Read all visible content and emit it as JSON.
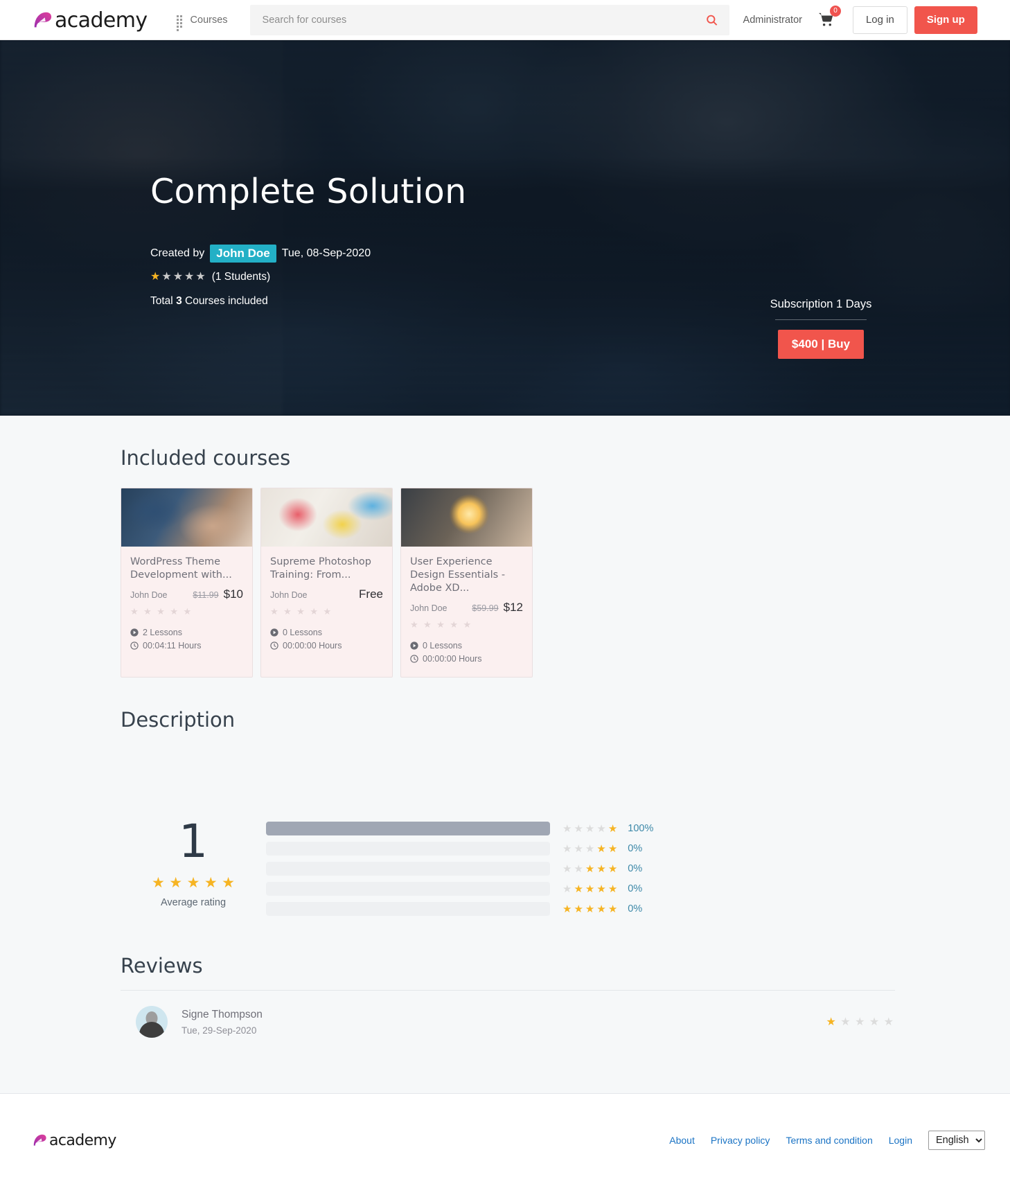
{
  "navbar": {
    "brand": "academy",
    "courses_label": "Courses",
    "search_placeholder": "Search for courses",
    "search_value": "",
    "search_icon": "search-icon",
    "grid_icon": "grid-icon",
    "admin_label": "Administrator",
    "cart_icon": "cart-icon",
    "cart_count": "0",
    "login_label": "Log in",
    "signup_label": "Sign up",
    "accent_red": "#f1554c"
  },
  "hero": {
    "title": "Complete Solution",
    "created_by_label": "Created by",
    "author": "John Doe",
    "created_date": "Tue, 08-Sep-2020",
    "rating_value": 1,
    "rating_max": 5,
    "students_text": "(1 Students)",
    "total_prefix": "Total",
    "total_count": "3",
    "total_suffix": "Courses included",
    "subscription_text": "Subscription 1 Days",
    "buy_label": "$400 | Buy",
    "author_chip_color": "#23b0c6"
  },
  "sections": {
    "included_courses": "Included courses",
    "description": "Description",
    "reviews": "Reviews"
  },
  "courses": [
    {
      "title": "WordPress Theme Development with...",
      "author": "John Doe",
      "price_old": "$11.99",
      "price_new": "$10",
      "stars": 0,
      "lessons": "2 Lessons",
      "hours": "00:04:11 Hours",
      "thumb": "thumb-a"
    },
    {
      "title": "Supreme Photoshop Training: From...",
      "author": "John Doe",
      "price_old": "",
      "price_new": "Free",
      "stars": 0,
      "lessons": "0 Lessons",
      "hours": "00:00:00 Hours",
      "thumb": "thumb-b"
    },
    {
      "title": "User Experience Design Essentials - Adobe XD...",
      "author": "John Doe",
      "price_old": "$59.99",
      "price_new": "$12",
      "stars": 0,
      "lessons": "0 Lessons",
      "hours": "00:00:00 Hours",
      "thumb": "thumb-c"
    }
  ],
  "rating_summary": {
    "average": "1",
    "average_stars": 5,
    "average_label": "Average rating",
    "rows": [
      {
        "stars_gold": 1,
        "percent": "100%",
        "fill": 100
      },
      {
        "stars_gold": 2,
        "percent": "0%",
        "fill": 0
      },
      {
        "stars_gold": 3,
        "percent": "0%",
        "fill": 0
      },
      {
        "stars_gold": 4,
        "percent": "0%",
        "fill": 0
      },
      {
        "stars_gold": 5,
        "percent": "0%",
        "fill": 0
      }
    ],
    "bar_fill_color": "#a0a7b4",
    "percent_color": "#3c88a8",
    "star_gold": "#f6b423"
  },
  "reviews": [
    {
      "name": "Signe Thompson",
      "date": "Tue, 29-Sep-2020",
      "rating": 1
    }
  ],
  "footer": {
    "brand": "academy",
    "links": [
      "About",
      "Privacy policy",
      "Terms and condition",
      "Login"
    ],
    "language": "English",
    "language_options": [
      "English"
    ],
    "link_color": "#1a73c4"
  }
}
